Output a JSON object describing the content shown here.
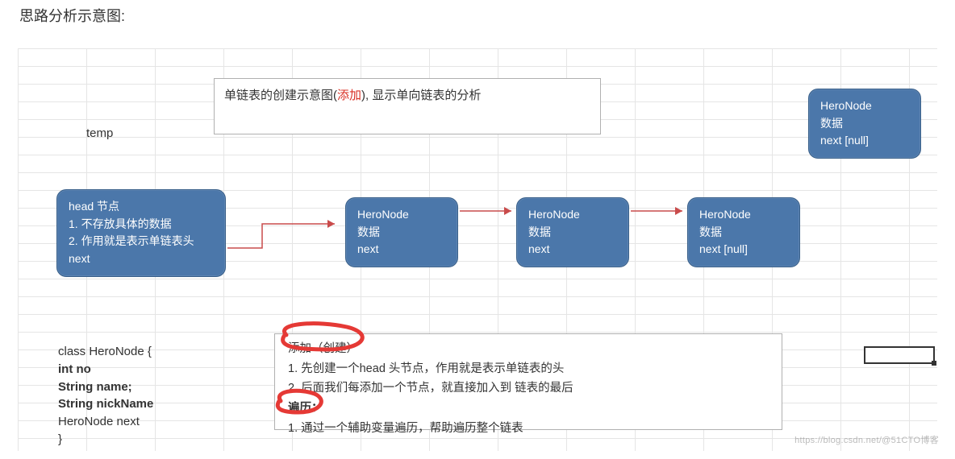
{
  "pageTitle": "思路分析示意图:",
  "titleBox": {
    "prefix": "单链表的创建示意图(",
    "red": "添加",
    "suffix": "), 显示单向链表的分析"
  },
  "tempLabel": "temp",
  "headNode": {
    "l1": "head 节点",
    "l2": "1. 不存放具体的数据",
    "l3": "2. 作用就是表示单链表头",
    "l4": "next"
  },
  "heroNode": {
    "l1": "HeroNode",
    "l2": "数据",
    "l3": "next"
  },
  "heroNodeLast": {
    "l1": "HeroNode",
    "l2": "数据",
    "l3": "next [null]"
  },
  "code": {
    "l1": "class HeroNode {",
    "l2": "int no",
    "l3": "String name;",
    "l4": "String nickName",
    "l5": "HeroNode next",
    "l6": "}"
  },
  "explain": {
    "l1": "添加（创建）",
    "l2": "1. 先创建一个head 头节点，作用就是表示单链表的头",
    "l3": "2. 后面我们每添加一个节点，就直接加入到 链表的最后",
    "l4": "遍历：",
    "l5": "1. 通过一个辅助变量遍历，帮助遍历整个链表"
  },
  "watermark": "https://blog.csdn.net/@51CTO博客"
}
